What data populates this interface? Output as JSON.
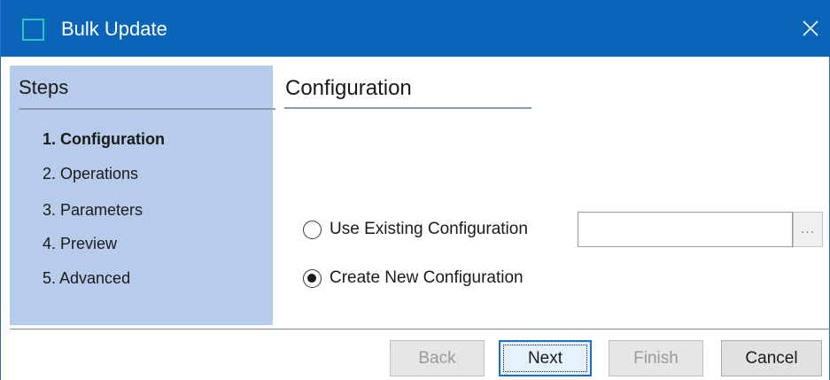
{
  "window": {
    "title": "Bulk Update",
    "close_icon": "close-icon"
  },
  "steps": {
    "header": "Steps",
    "items": [
      {
        "label": "1. Configuration",
        "active": true
      },
      {
        "label": "2. Operations",
        "active": false
      },
      {
        "label": "3. Parameters",
        "active": false
      },
      {
        "label": "4. Preview",
        "active": false
      },
      {
        "label": "5. Advanced",
        "active": false
      }
    ]
  },
  "configuration": {
    "header": "Configuration",
    "use_existing_label": "Use Existing Configuration",
    "use_existing_checked": false,
    "existing_value": "",
    "browse_label": "...",
    "create_new_label": "Create New Configuration",
    "create_new_checked": true
  },
  "buttons": {
    "back": {
      "label": "Back",
      "enabled": false
    },
    "next": {
      "label": "Next",
      "enabled": true,
      "default": true
    },
    "finish": {
      "label": "Finish",
      "enabled": false
    },
    "cancel": {
      "label": "Cancel",
      "enabled": true
    }
  },
  "colors": {
    "titlebar": "#0a64b8",
    "steps_panel": "#b7ccea",
    "app_icon_accent": "#2ec4c7",
    "default_button_border": "#1a6fc4"
  }
}
